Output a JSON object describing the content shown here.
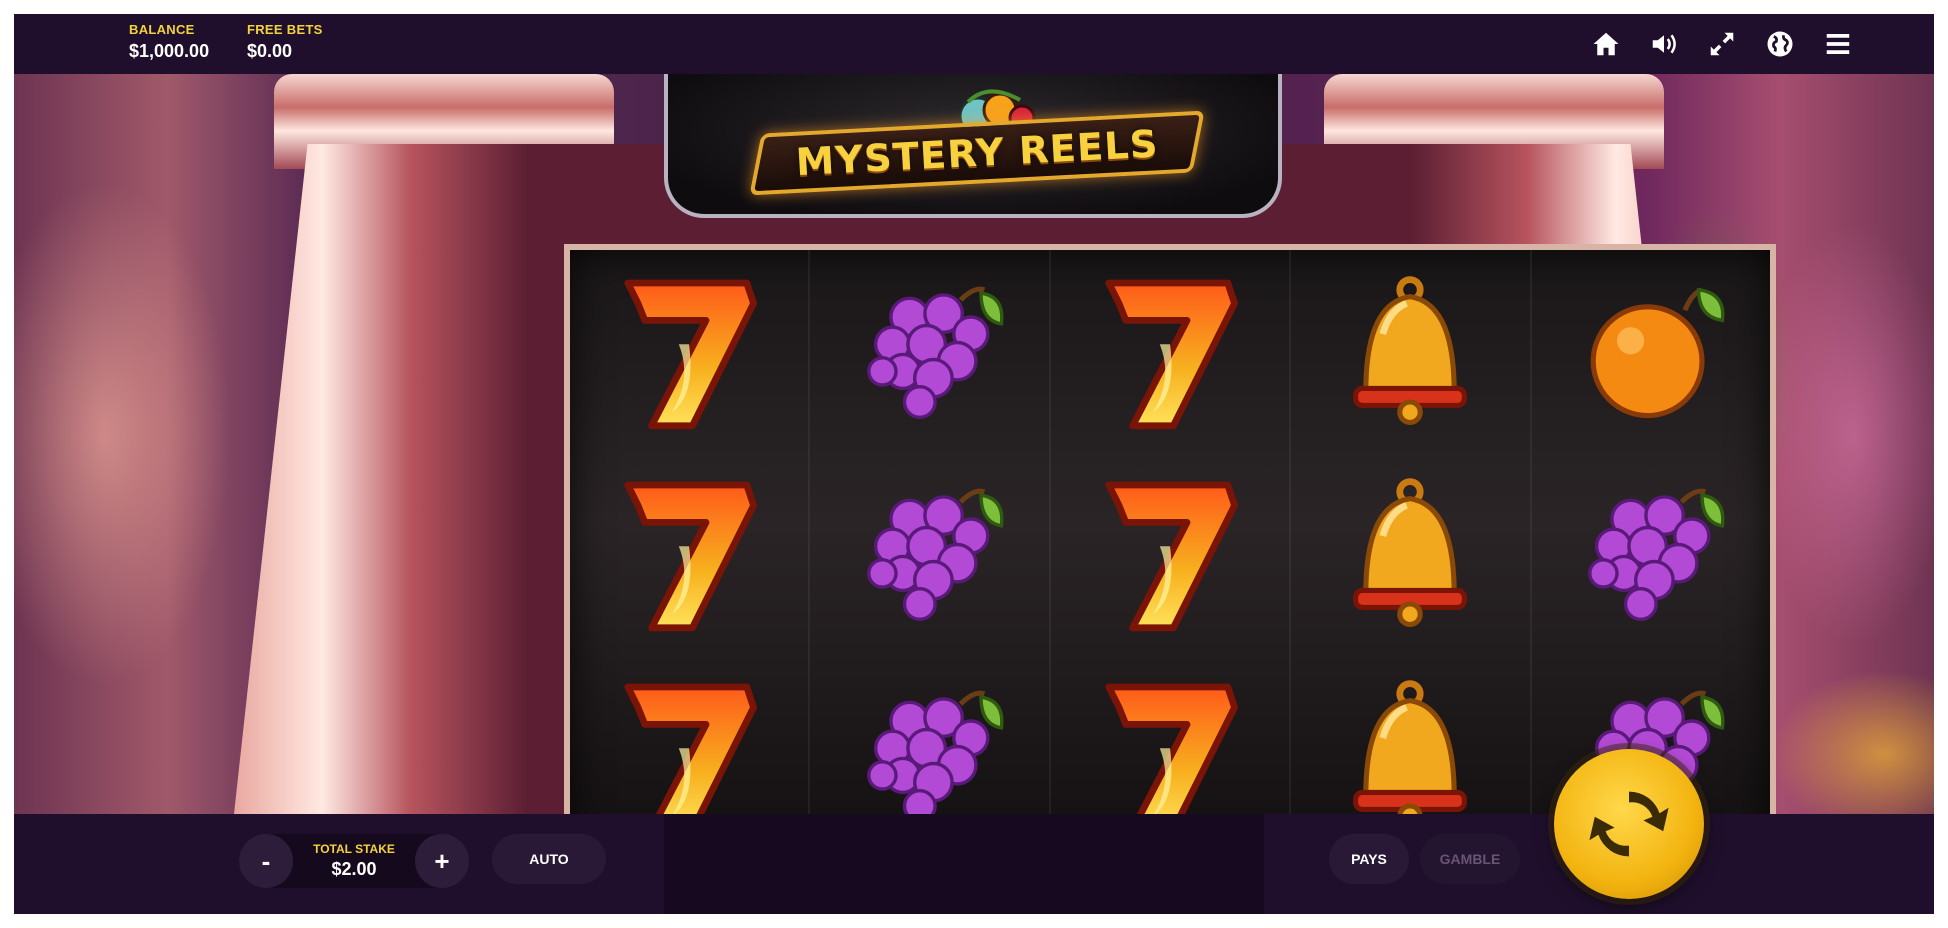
{
  "header": {
    "balance_label": "BALANCE",
    "balance_value": "$1,000.00",
    "free_bets_label": "FREE BETS",
    "free_bets_value": "$0.00",
    "icons": [
      "home-icon",
      "sound-icon",
      "fullscreen-icon",
      "globe-icon",
      "menu-icon"
    ]
  },
  "game": {
    "title": "MYSTERY REELS",
    "reels": [
      [
        "seven",
        "seven",
        "seven"
      ],
      [
        "grapes",
        "grapes",
        "grapes"
      ],
      [
        "seven",
        "seven",
        "seven"
      ],
      [
        "bell",
        "bell",
        "bell"
      ],
      [
        "orange",
        "grapes",
        "grapes"
      ]
    ]
  },
  "controls": {
    "minus_label": "-",
    "stake_label": "TOTAL STAKE",
    "stake_value": "$2.00",
    "plus_label": "+",
    "auto_label": "AUTO",
    "pays_label": "PAYS",
    "gamble_label": "GAMBLE",
    "spin_icon": "spin-icon"
  },
  "colors": {
    "accent_yellow": "#f3d33a",
    "bar_background": "#1f0f2c",
    "spin_gold": "#f3b410"
  }
}
